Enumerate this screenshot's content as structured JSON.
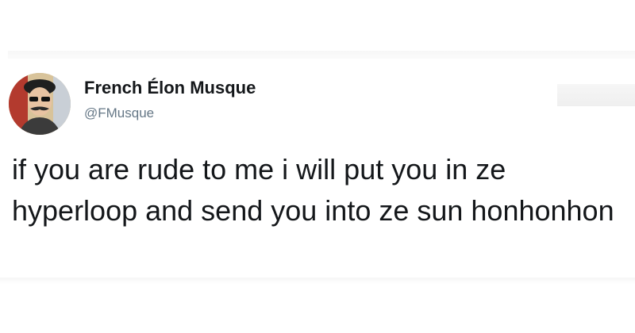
{
  "tweet": {
    "author": {
      "display_name": "French Élon Musque",
      "handle": "@FMusque",
      "avatar_icon": "profile-photo-avatar"
    },
    "text": "if you are rude to me i will put you in ze hyperloop and send you into ze sun honhonhon"
  },
  "colors": {
    "name": "#14171a",
    "handle": "#657786",
    "text": "#14171a",
    "background": "#ffffff"
  }
}
